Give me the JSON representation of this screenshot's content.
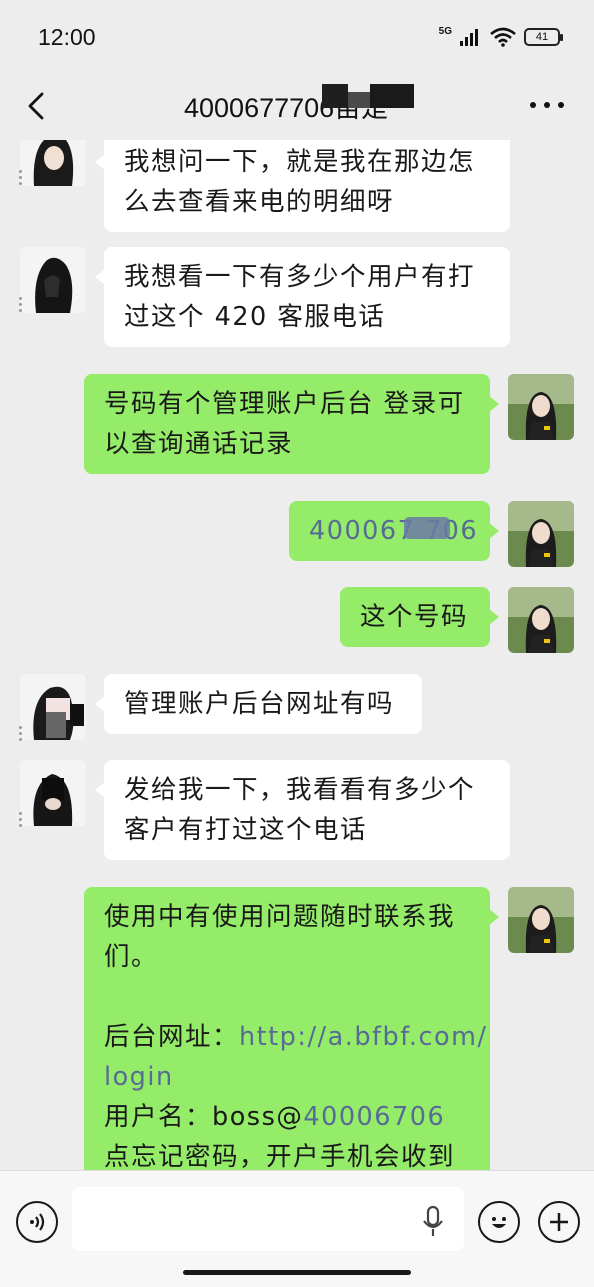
{
  "status_bar": {
    "time": "12:00",
    "network": "5G",
    "battery": "41"
  },
  "nav": {
    "title": "4000677706苗是"
  },
  "messages": [
    {
      "side": "in",
      "lines": [
        "我想问一下，就是我在那边怎",
        "么去查看来电的明细呀"
      ]
    },
    {
      "side": "in",
      "lines": [
        "我想看一下有多少个用户有打",
        "过这个 420 客服电话"
      ]
    },
    {
      "side": "out",
      "lines": [
        "号码有个管理账户后台 登录可",
        "以查询通话记录"
      ]
    },
    {
      "side": "out",
      "lines": [
        "400067 706"
      ]
    },
    {
      "side": "out",
      "lines": [
        "这个号码"
      ]
    },
    {
      "side": "in",
      "lines": [
        "管理账户后台网址有吗"
      ]
    },
    {
      "side": "in",
      "lines": [
        "发给我一下，我看看有多少个",
        "客户有打过这个电话"
      ]
    },
    {
      "side": "out",
      "lines": [
        "使用中有使用问题随时联系我",
        "们。",
        "",
        "后台网址：",
        "http://a.bfbf.com/",
        "login",
        "用户名：",
        "boss@",
        "40006",
        "706",
        "点忘记密码，开户手机会收到"
      ]
    }
  ],
  "input_bar": {
    "placeholder": ""
  },
  "colors": {
    "background": "#ededed",
    "bubble_in": "#ffffff",
    "bubble_out": "#95ec69",
    "link": "#576b95"
  },
  "icons": [
    "back-arrow-icon",
    "more-dots-icon",
    "voice-icon",
    "microphone-icon",
    "emoji-icon",
    "plus-icon"
  ]
}
